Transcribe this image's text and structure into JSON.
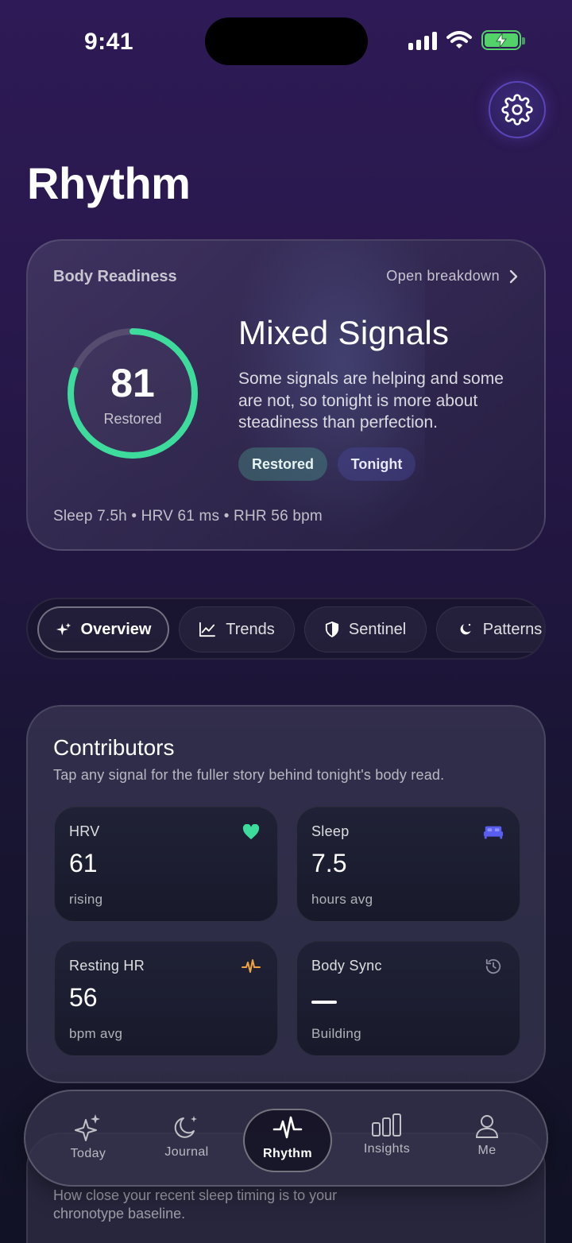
{
  "status_bar": {
    "time": "9:41"
  },
  "header": {
    "title": "Rhythm"
  },
  "readiness": {
    "label": "Body Readiness",
    "link": "Open breakdown",
    "score": "81",
    "score_fraction": 0.81,
    "score_label": "Restored",
    "headline": "Mixed Signals",
    "summary": "Some signals are helping and some are not, so tonight is more about steadiness than perfection.",
    "chips": [
      "Restored",
      "Tonight"
    ],
    "stats": "Sleep 7.5h  •  HRV 61 ms  •  RHR 56 bpm",
    "ring_color": "#3ddc9c"
  },
  "tabs": [
    {
      "label": "Overview",
      "icon": "sparkle-icon",
      "active": true
    },
    {
      "label": "Trends",
      "icon": "trend-chart-icon"
    },
    {
      "label": "Sentinel",
      "icon": "shield-icon"
    },
    {
      "label": "Patterns",
      "icon": "moon-icon"
    }
  ],
  "contributors": {
    "title": "Contributors",
    "subtitle": "Tap any signal for the fuller story behind tonight's body read.",
    "tiles": [
      {
        "name": "HRV",
        "value": "61",
        "unit": "rising",
        "icon": "heart-icon",
        "icon_color": "#3ddc9c"
      },
      {
        "name": "Sleep",
        "value": "7.5",
        "unit": "hours avg",
        "icon": "bed-icon",
        "icon_color": "#5a5ef0"
      },
      {
        "name": "Resting HR",
        "value": "56",
        "unit": "bpm avg",
        "icon": "pulse-icon",
        "icon_color": "#f0a340"
      },
      {
        "name": "Body Sync",
        "value": "",
        "unit": "Building",
        "icon": "history-icon",
        "icon_color": "#8a8aa0"
      }
    ]
  },
  "sleep_card": {
    "subtitle": "How close your recent sleep timing is to your chronotype baseline."
  },
  "nav": [
    {
      "label": "Today",
      "icon": "sparkles-icon"
    },
    {
      "label": "Journal",
      "icon": "moon-star-icon"
    },
    {
      "label": "Rhythm",
      "icon": "pulse-icon",
      "active": true
    },
    {
      "label": "Insights",
      "icon": "bar-chart-icon"
    },
    {
      "label": "Me",
      "icon": "person-icon"
    }
  ]
}
